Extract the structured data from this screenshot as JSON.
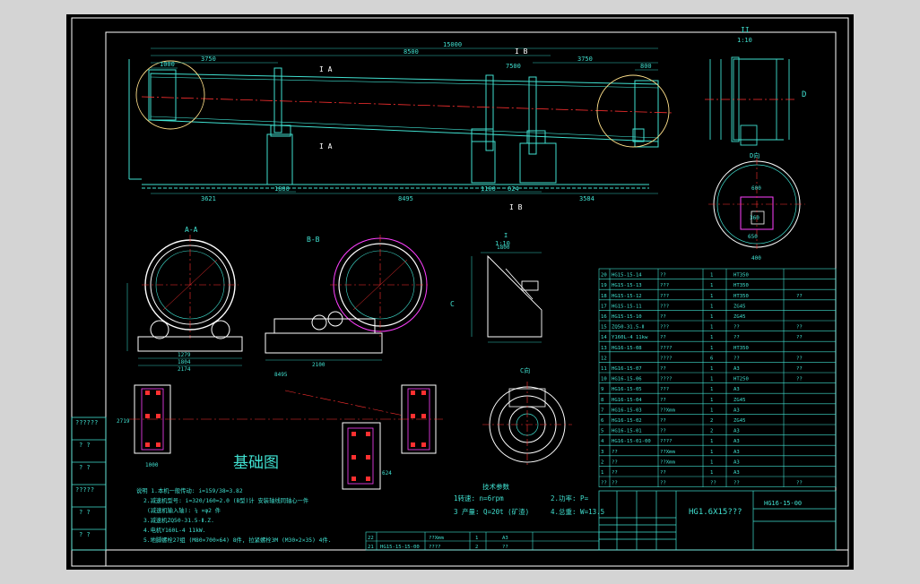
{
  "drawing": {
    "title_block": {
      "name": "HG1.6X15???",
      "drawing_no": "HG16-15-00"
    },
    "views": {
      "a_a": "A-A",
      "b_b": "B-B",
      "c_view": "C向",
      "d_view": "D向",
      "detail_i": "I",
      "detail_i_scale": "1:10",
      "detail_ii": "II",
      "detail_ii_scale": "1:10",
      "foundation": "基础图",
      "tech_params": "技术参数",
      "label_ia": "I A",
      "label_ib": "I B",
      "label_c": "C",
      "label_d": "D"
    },
    "dims": {
      "total_length": "15000",
      "d8500": "8500",
      "d3750a": "3750",
      "d3750b": "3750",
      "d7500": "7500",
      "d1000": "1000",
      "d800": "800",
      "d3621": "3621",
      "d8495": "8495",
      "d3584": "3584",
      "d1800": "1800",
      "d2871": "2871",
      "d2719": "2719",
      "d2100": "2100",
      "d1279": "1279",
      "d1804": "1804",
      "d2174": "2174",
      "d1100": "1100",
      "d624": "624",
      "d1000b": "1000",
      "d650": "650",
      "d400": "400",
      "d600": "600",
      "d360": "360",
      "d1800b": "1800",
      "d1600": "ø1600",
      "d1780": "ø1780"
    },
    "tech": {
      "speed": "1转速: n=6rpm",
      "power": "2.功率: P=",
      "capacity": "3 产量: Q=20t (矿渣)",
      "weight": "4.总重: W=13.5"
    },
    "notes": [
      "说明 1.本机一般传动: i=159/38=3.82",
      "2.减速机型号: i=320/160=2.0 (B型)计  安装轴线同轴心一件",
      "(减速机输入轴): ¼ ×φ2  件",
      "3.减速机ZQ50-31.5-Ⅱ.Z.",
      "4.电机Y160L-4  11kW.",
      "5.地脚螺栓27组 (M80×700×64) 8件, 拉紧螺栓3M (M30×2×35) 4件."
    ],
    "parts": [
      {
        "no": "20",
        "code": "HG15-15-14",
        "name": "??",
        "qty": "1",
        "mat": "HT350",
        "note": ""
      },
      {
        "no": "19",
        "code": "HG15-15-13",
        "name": "???",
        "qty": "1",
        "mat": "HT350",
        "note": ""
      },
      {
        "no": "18",
        "code": "HG15-15-12",
        "name": "???",
        "qty": "1",
        "mat": "HT350",
        "note": "??"
      },
      {
        "no": "17",
        "code": "HG15-15-11",
        "name": "???",
        "qty": "1",
        "mat": "ZG45",
        "note": ""
      },
      {
        "no": "16",
        "code": "HG15-15-10",
        "name": "??",
        "qty": "1",
        "mat": "ZG45",
        "note": ""
      },
      {
        "no": "15",
        "code": "ZQ50-31.5-Ⅱ",
        "name": "???",
        "qty": "1",
        "mat": "??",
        "note": "??"
      },
      {
        "no": "14",
        "code": "Y160L-4 11kw",
        "name": "??",
        "qty": "1",
        "mat": "??",
        "note": "??"
      },
      {
        "no": "13",
        "code": "HG16-15-08",
        "name": "????",
        "qty": "1",
        "mat": "HT350",
        "note": ""
      },
      {
        "no": "12",
        "code": "",
        "name": "????",
        "qty": "6",
        "mat": "??",
        "note": "??"
      },
      {
        "no": "11",
        "code": "HG16-15-07",
        "name": "??",
        "qty": "1",
        "mat": "A3",
        "note": "??"
      },
      {
        "no": "10",
        "code": "HG16-15-06",
        "name": "????",
        "qty": "1",
        "mat": "HT250",
        "note": "??"
      },
      {
        "no": "9",
        "code": "HG16-15-05",
        "name": "???",
        "qty": "1",
        "mat": "A3",
        "note": ""
      },
      {
        "no": "8",
        "code": "HG16-15-04",
        "name": "??",
        "qty": "1",
        "mat": "ZG45",
        "note": ""
      },
      {
        "no": "7",
        "code": "HG16-15-03",
        "name": "??Xmm",
        "qty": "1",
        "mat": "A3",
        "note": ""
      },
      {
        "no": "6",
        "code": "HG16-15-02",
        "name": "??",
        "qty": "2",
        "mat": "ZG45",
        "note": ""
      },
      {
        "no": "5",
        "code": "HG16-15-01",
        "name": "??",
        "qty": "2",
        "mat": "A3",
        "note": ""
      },
      {
        "no": "4",
        "code": "HG16-15-01-00",
        "name": "????",
        "qty": "1",
        "mat": "A3",
        "note": ""
      },
      {
        "no": "3",
        "code": "??",
        "name": "??Xmm",
        "qty": "1",
        "mat": "A3",
        "note": ""
      },
      {
        "no": "2",
        "code": "??",
        "name": "??Xmm",
        "qty": "1",
        "mat": "A3",
        "note": ""
      },
      {
        "no": "1",
        "code": "??",
        "name": "??",
        "qty": "1",
        "mat": "A3",
        "note": ""
      }
    ],
    "parts_header": {
      "no": "??",
      "code": "??",
      "name": "??",
      "qty": "??",
      "mat": "??",
      "note": "??"
    },
    "lower_parts": [
      {
        "no": "22",
        "code": "??",
        "name": "??Xmm",
        "qty": "1",
        "mat": "A3"
      },
      {
        "no": "21",
        "code": "HG15-15-15-00",
        "name": "????",
        "qty": "2",
        "mat": "??"
      }
    ],
    "left_strip": [
      "??????",
      "? ?",
      "? ?",
      "?????",
      "? ?",
      "? ?"
    ],
    "colors": {
      "frame": "#ffffff",
      "line": "#40e0d0",
      "centerline": "#ff3030",
      "detail": "#ff40ff",
      "highlight": "#ffe08a",
      "dim": "#2ec4b6"
    }
  }
}
